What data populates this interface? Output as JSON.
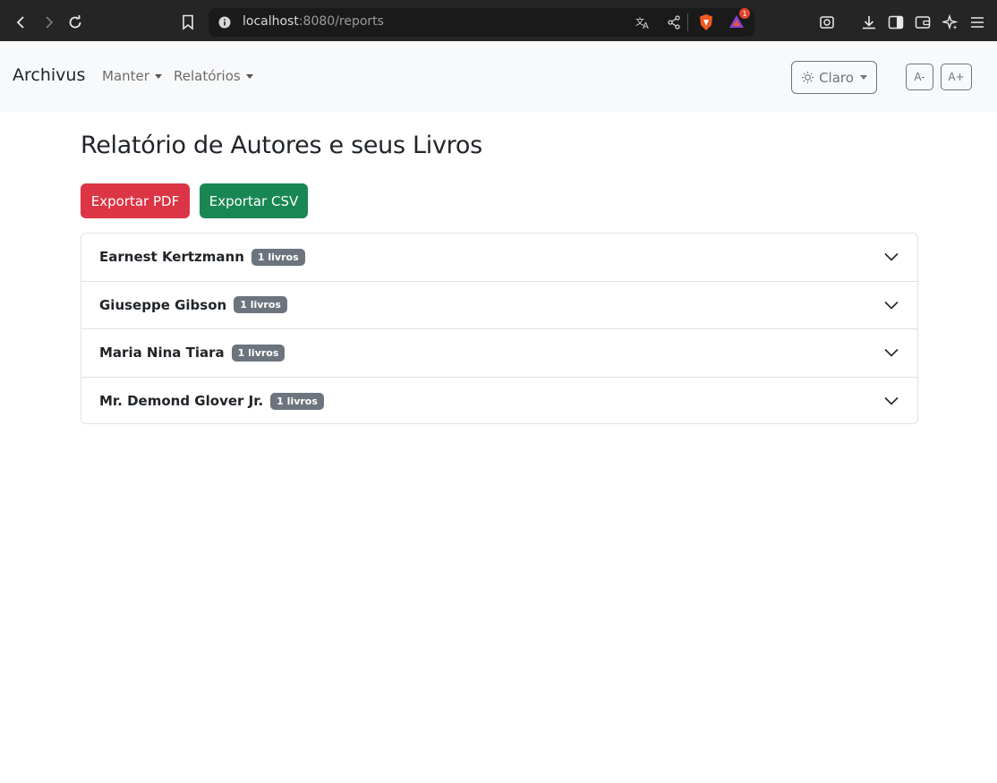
{
  "browser": {
    "url_host": "localhost",
    "url_rest": ":8080/reports",
    "notification_count": "1"
  },
  "navbar": {
    "brand": "Archivus",
    "menus": [
      {
        "label": "Manter"
      },
      {
        "label": "Relatórios"
      }
    ],
    "theme_label": "Claro",
    "font_decrease": "A-",
    "font_increase": "A+"
  },
  "main": {
    "title": "Relatório de Autores e seus Livros",
    "export_pdf": "Exportar PDF",
    "export_csv": "Exportar CSV",
    "authors": [
      {
        "name": "Earnest Kertzmann",
        "badge": "1 livros"
      },
      {
        "name": "Giuseppe Gibson",
        "badge": "1 livros"
      },
      {
        "name": "Maria Nina Tiara",
        "badge": "1 livros"
      },
      {
        "name": "Mr. Demond Glover Jr.",
        "badge": "1 livros"
      }
    ]
  },
  "colors": {
    "danger": "#dc3545",
    "success": "#198754",
    "secondary": "#6c757d",
    "navbar_bg": "#f8f9fa",
    "chrome_bg": "#252525"
  },
  "icons": [
    "back-icon",
    "forward-icon",
    "reload-icon",
    "bookmark-icon",
    "info-icon",
    "translate-icon",
    "share-icon",
    "brave-shield-icon",
    "brave-rewards-icon",
    "screenshot-icon",
    "download-icon",
    "sidebar-icon",
    "wallet-icon",
    "leo-ai-icon",
    "menu-icon",
    "sun-icon",
    "chevron-down-icon"
  ]
}
